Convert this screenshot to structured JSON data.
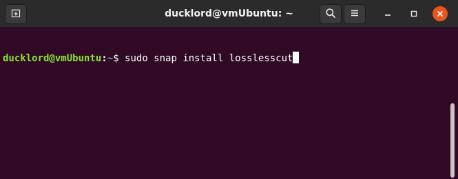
{
  "window": {
    "title": "ducklord@vmUbuntu: ~"
  },
  "header": {
    "new_tab_icon": "new-tab-icon",
    "search_icon": "search-icon",
    "menu_icon": "hamburger-menu-icon",
    "minimize_icon": "minimize-icon",
    "maximize_icon": "maximize-icon",
    "close_icon": "close-icon"
  },
  "terminal": {
    "prompt_user_host": "ducklord@vmUbuntu",
    "prompt_separator": ":",
    "prompt_path": "~",
    "prompt_symbol": "$ ",
    "command": "sudo snap install losslesscut"
  },
  "colors": {
    "terminal_background": "#300a24",
    "titlebar_background": "#2b2b2b",
    "prompt_user_color": "#8ae234",
    "prompt_path_color": "#729fcf",
    "close_button_color": "#e95420"
  }
}
